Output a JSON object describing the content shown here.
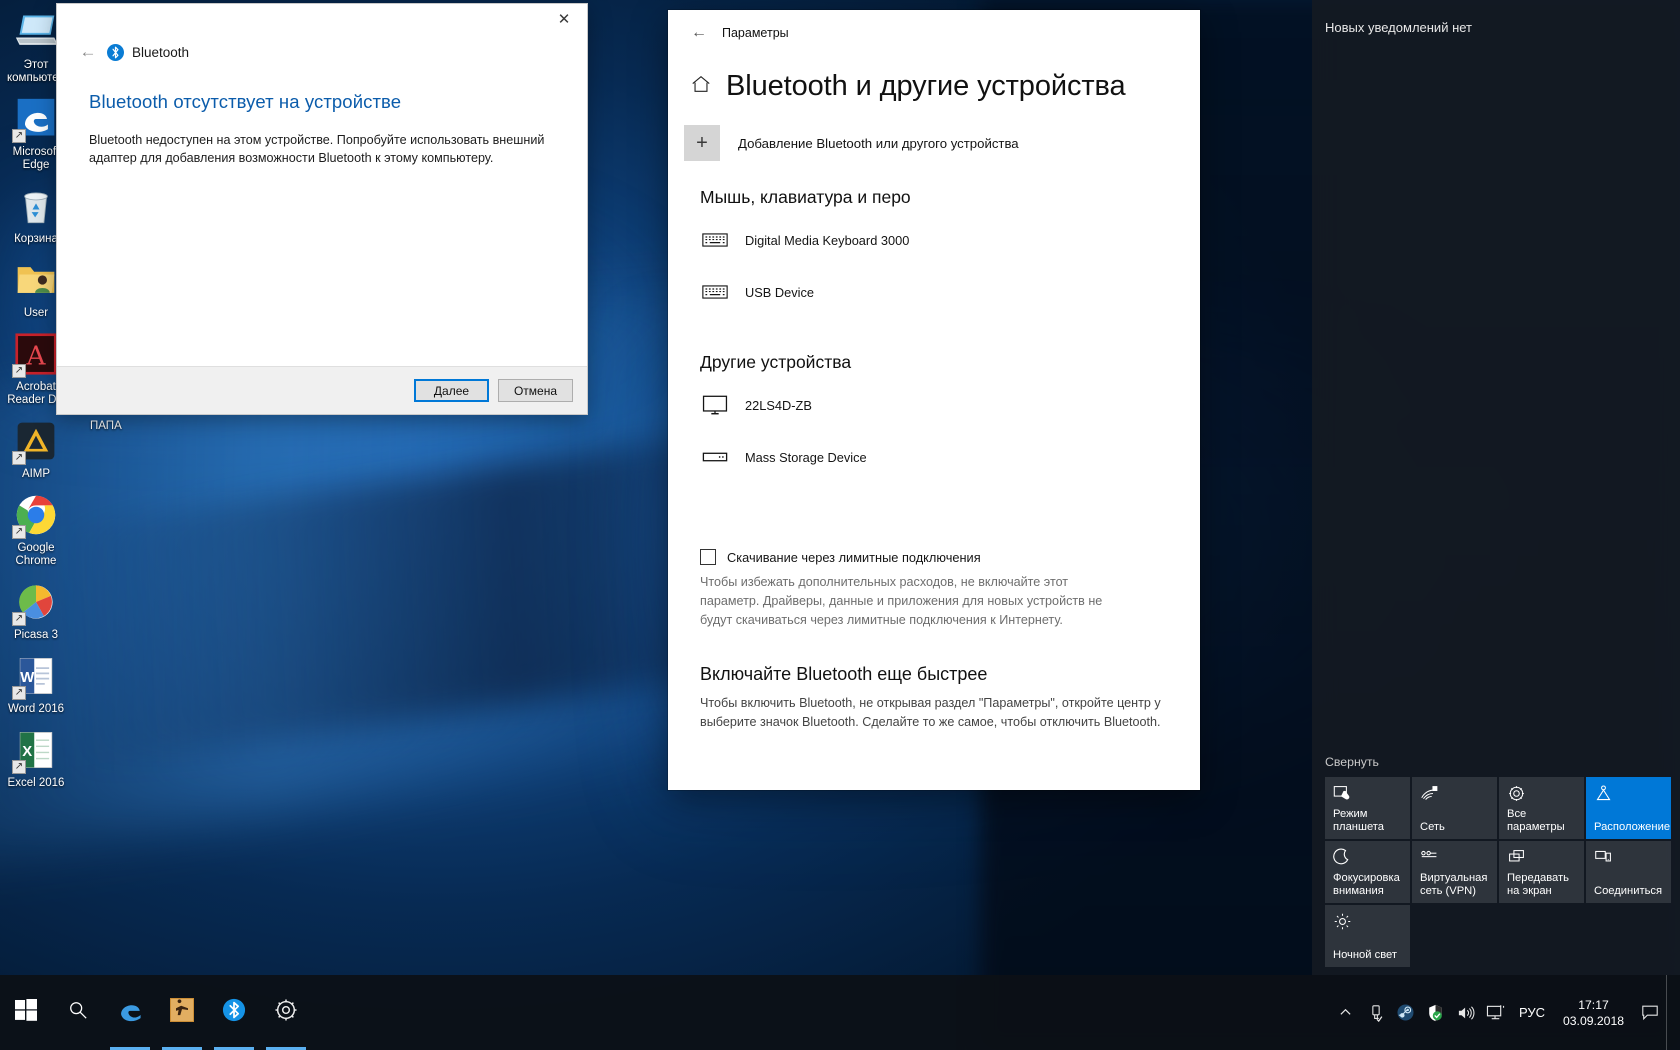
{
  "desktop": {
    "icons": [
      {
        "name": "this-pc",
        "label": "Этот компьютер",
        "icon": "computer-icon"
      },
      {
        "name": "microsoft-edge",
        "label": "Microsoft Edge",
        "icon": "edge-icon"
      },
      {
        "name": "recycle-bin",
        "label": "Корзина",
        "icon": "recycle-bin-icon"
      },
      {
        "name": "user-folder",
        "label": "User",
        "icon": "user-folder-icon"
      },
      {
        "name": "acrobat-reader",
        "label": "Acrobat Reader DC",
        "icon": "acrobat-icon"
      },
      {
        "name": "aimp",
        "label": "AIMP",
        "icon": "aimp-icon"
      },
      {
        "name": "google-chrome",
        "label": "Google Chrome",
        "icon": "chrome-icon"
      },
      {
        "name": "picasa",
        "label": "Picasa 3",
        "icon": "picasa-icon"
      },
      {
        "name": "word",
        "label": "Word 2016",
        "icon": "word-icon"
      },
      {
        "name": "excel",
        "label": "Excel 2016",
        "icon": "excel-icon"
      }
    ],
    "stray_label": "ПАПА"
  },
  "bluetooth_dialog": {
    "brand_label": "Bluetooth",
    "heading": "Bluetooth отсутствует на устройстве",
    "description": "Bluetooth недоступен на этом устройстве. Попробуйте использовать внешний адаптер для добавления возможности Bluetooth к этому компьютеру.",
    "next_label": "Далее",
    "cancel_label": "Отмена",
    "close_glyph": "✕",
    "back_glyph": "←"
  },
  "settings": {
    "app_title": "Параметры",
    "page_title": "Bluetooth и другие устройства",
    "back_glyph": "←",
    "add_device": {
      "label": "Добавление Bluetooth или другого устройства",
      "plus": "+"
    },
    "groups": [
      {
        "title": "Мышь, клавиатура и перо",
        "devices": [
          {
            "name": "Digital Media Keyboard 3000",
            "icon": "keyboard-icon"
          },
          {
            "name": "USB Device",
            "icon": "keyboard-icon"
          }
        ]
      },
      {
        "title": "Другие устройства",
        "devices": [
          {
            "name": "22LS4D-ZB",
            "icon": "monitor-icon"
          },
          {
            "name": "Mass Storage Device",
            "icon": "storage-icon"
          }
        ]
      }
    ],
    "metered": {
      "checkbox_label": "Скачивание через лимитные подключения",
      "checked": false,
      "description": "Чтобы избежать дополнительных расходов, не включайте этот параметр. Драйверы, данные и приложения для новых устройств не будут скачиваться через лимитные подключения к Интернету."
    },
    "faster": {
      "heading": "Включайте Bluetooth еще быстрее",
      "description": "Чтобы включить Bluetooth, не открывая раздел \"Параметры\", откройте центр у выберите значок Bluetooth. Сделайте то же самое, чтобы отключить Bluetooth."
    }
  },
  "action_center": {
    "empty_text": "Новых уведомлений нет",
    "collapse_label": "Свернуть",
    "tiles": [
      {
        "label": "Режим планшета",
        "icon": "tablet-mode-icon",
        "active": false
      },
      {
        "label": "Сеть",
        "icon": "network-icon",
        "active": false
      },
      {
        "label": "Все параметры",
        "icon": "gear-icon",
        "active": false
      },
      {
        "label": "Расположение",
        "icon": "location-icon",
        "active": true
      },
      {
        "label": "Фокусировка внимания",
        "icon": "moon-icon",
        "active": false
      },
      {
        "label": "Виртуальная сеть (VPN)",
        "icon": "vpn-icon",
        "active": false
      },
      {
        "label": "Передавать на экран",
        "icon": "project-icon",
        "active": false
      },
      {
        "label": "Соединиться",
        "icon": "connect-icon",
        "active": false
      },
      {
        "label": "Ночной свет",
        "icon": "sun-icon",
        "active": false
      }
    ]
  },
  "taskbar": {
    "items": [
      {
        "name": "start-button",
        "icon": "windows-logo-icon",
        "running": false
      },
      {
        "name": "search-button",
        "icon": "search-icon",
        "running": false
      },
      {
        "name": "taskbar-edge",
        "icon": "edge-icon",
        "running": true
      },
      {
        "name": "taskbar-csgo",
        "icon": "csgo-icon",
        "running": true
      },
      {
        "name": "taskbar-bluetooth",
        "icon": "bluetooth-icon",
        "running": true
      },
      {
        "name": "taskbar-settings",
        "icon": "gear-icon",
        "running": true
      }
    ],
    "tray": [
      {
        "name": "tray-chevron-up-icon",
        "glyph": "chevron-up"
      },
      {
        "name": "tray-usb-icon",
        "glyph": "usb"
      },
      {
        "name": "tray-steam-icon",
        "glyph": "steam"
      },
      {
        "name": "tray-defender-icon",
        "glyph": "shield"
      },
      {
        "name": "tray-volume-icon",
        "glyph": "volume"
      },
      {
        "name": "tray-display-icon",
        "glyph": "display"
      }
    ],
    "language": "РУС",
    "time": "17:17",
    "date": "03.09.2018"
  },
  "colors": {
    "accent": "#0078d7",
    "link": "#0b5cab",
    "taskbar": "#0c1016",
    "action_center": "rgba(20,26,34,0.88)"
  }
}
